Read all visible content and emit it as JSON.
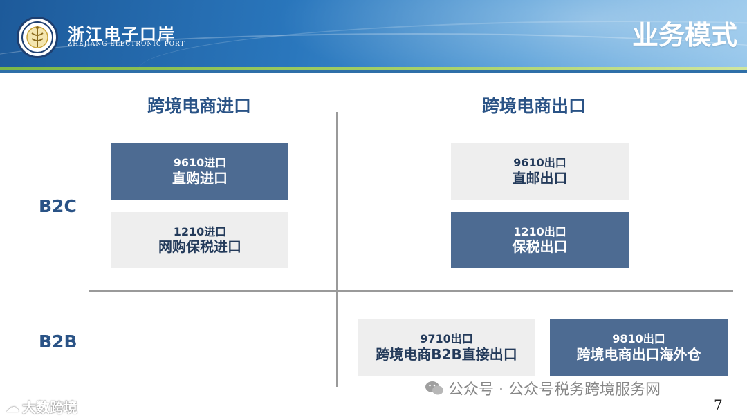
{
  "header": {
    "logo_cn": "浙江电子口岸",
    "logo_en": "ZHEJIANG ELECTRONIC PORT",
    "title": "业务模式"
  },
  "columns": {
    "import": "跨境电商进口",
    "export": "跨境电商出口"
  },
  "rows": {
    "b2c": "B2C",
    "b2b": "B2B"
  },
  "boxes": {
    "i9610": {
      "code": "9610进口",
      "name": "直购进口"
    },
    "i1210": {
      "code": "1210进口",
      "name": "网购保税进口"
    },
    "e9610": {
      "code": "9610出口",
      "name": "直邮出口"
    },
    "e1210": {
      "code": "1210出口",
      "name": "保税出口"
    },
    "e9710": {
      "code": "9710出口",
      "name": "跨境电商B2B直接出口"
    },
    "e9810": {
      "code": "9810出口",
      "name": "跨境电商出口海外仓"
    }
  },
  "footer": {
    "watermark_left": "大数跨境",
    "watermark_right": "公众号 · 公众号税务跨境服务网",
    "page_number": "7"
  },
  "colors": {
    "header_blue": "#2a77bd",
    "accent_green": "#7ab648",
    "box_dark": "#4d6b92",
    "box_light": "#eeeeee",
    "label_blue": "#2a5386"
  }
}
